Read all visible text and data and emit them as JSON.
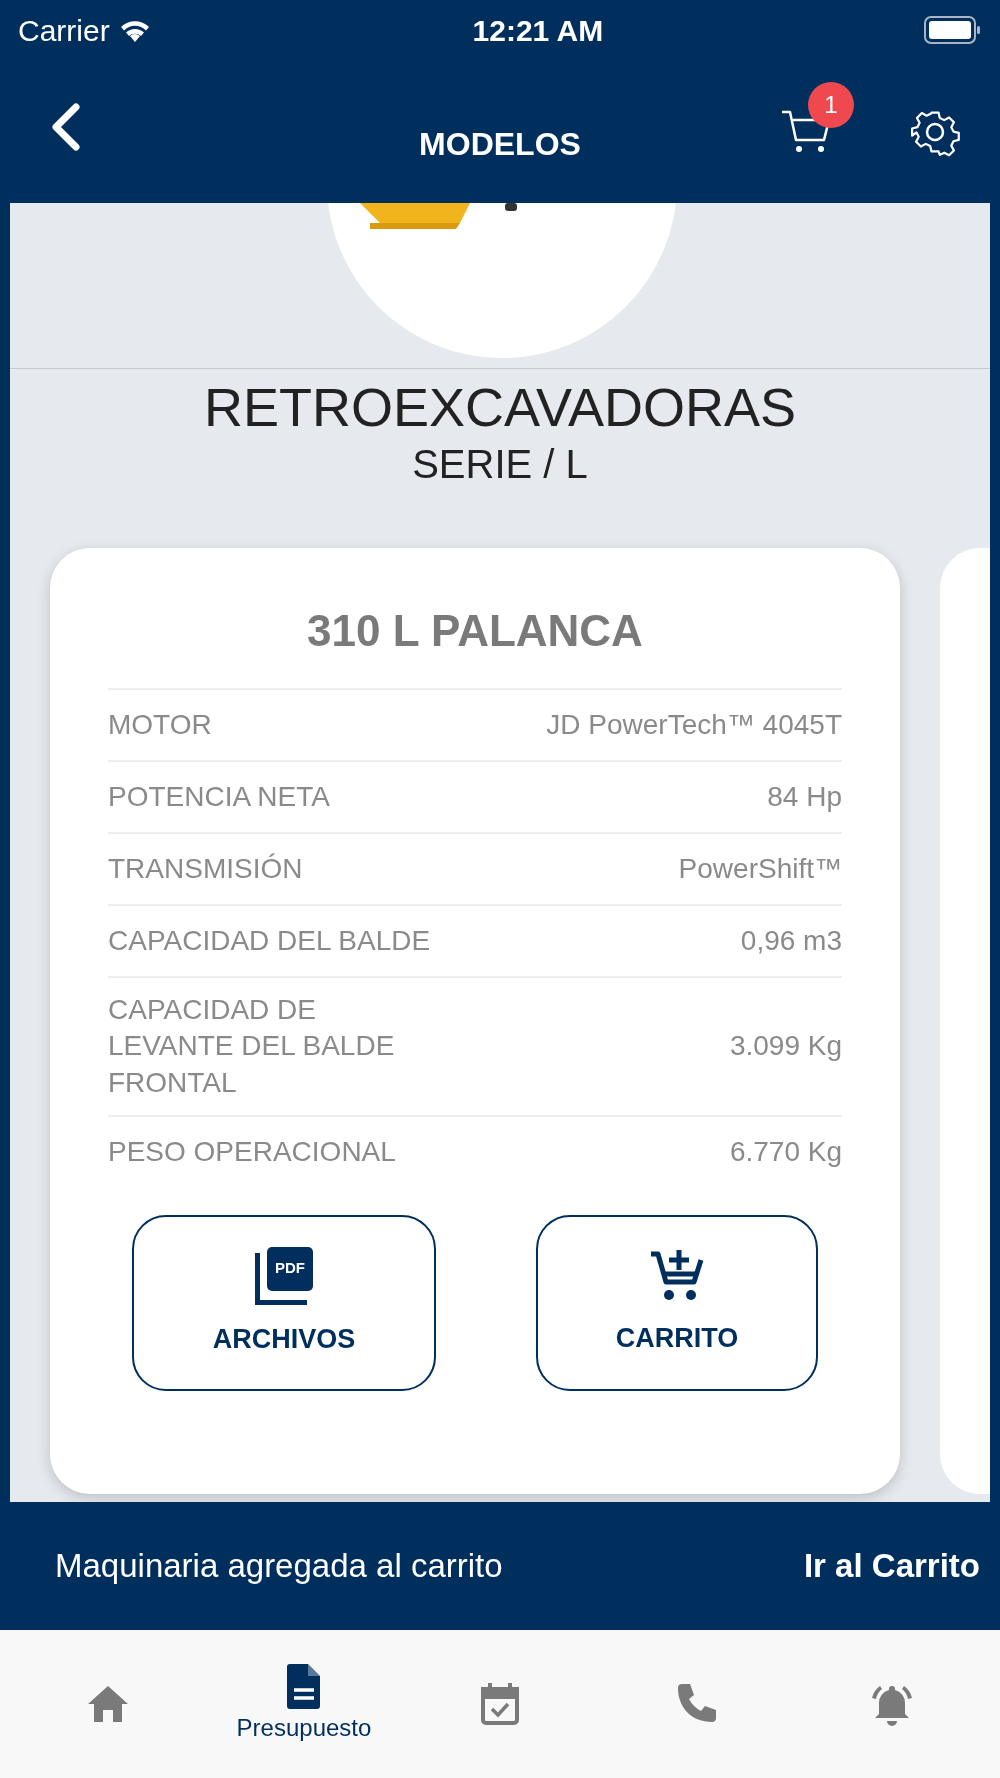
{
  "status_bar": {
    "carrier": "Carrier",
    "time": "12:21 AM"
  },
  "nav_bar": {
    "title": "MODELOS",
    "cart_count": "1"
  },
  "header": {
    "title": "RETROEXCAVADORAS",
    "subtitle": "SERIE / L"
  },
  "card": {
    "title": "310 L PALANCA",
    "specs": [
      {
        "label": "MOTOR",
        "value": "JD PowerTech™ 4045T"
      },
      {
        "label": "POTENCIA NETA",
        "value": "84 Hp"
      },
      {
        "label": "TRANSMISIÓN",
        "value": "PowerShift™"
      },
      {
        "label": "CAPACIDAD DEL BALDE",
        "value": "0,96 m3"
      },
      {
        "label": "CAPACIDAD DE LEVANTE DEL BALDE FRONTAL",
        "value": "3.099 Kg"
      },
      {
        "label": "PESO OPERACIONAL",
        "value": "6.770 Kg"
      }
    ],
    "buttons": [
      {
        "kind": "files",
        "label": "ARCHIVOS",
        "icon_text": "PDF"
      },
      {
        "kind": "cart",
        "label": "CARRITO"
      }
    ]
  },
  "snackbar": {
    "message": "Maquinaria agregada al carrito",
    "action": "Ir al Carrito"
  },
  "tab_bar": [
    {
      "kind": "home",
      "selected": false
    },
    {
      "kind": "quote",
      "label": "Presupuesto",
      "selected": true
    },
    {
      "kind": "calendar",
      "selected": false
    },
    {
      "kind": "phone",
      "selected": false
    },
    {
      "kind": "alarm",
      "selected": false
    }
  ]
}
